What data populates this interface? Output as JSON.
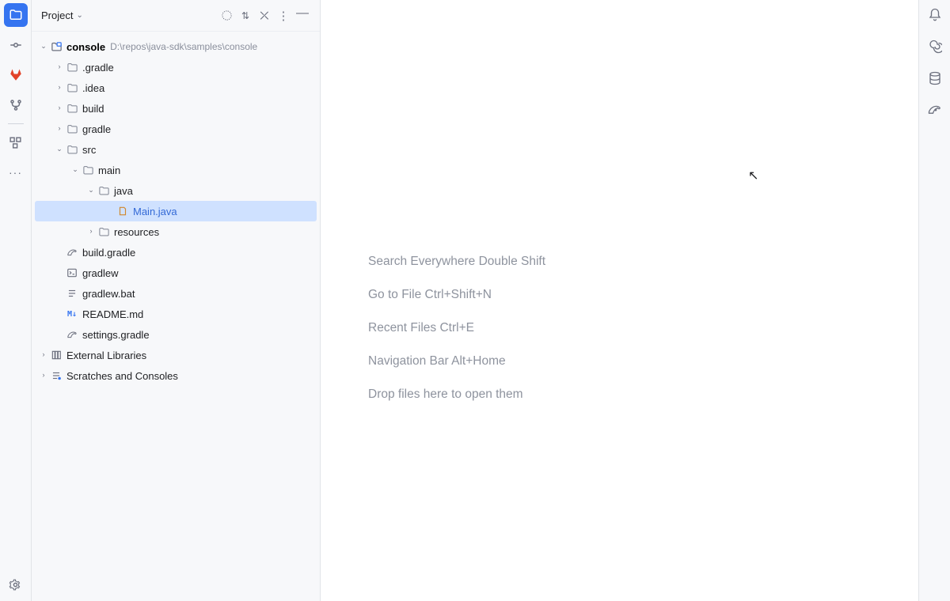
{
  "project_panel": {
    "title": "Project",
    "root": {
      "name": "console",
      "path": "D:\\repos\\java-sdk\\samples\\console"
    },
    "nodes": [
      {
        "depth": 0,
        "arrow": "open",
        "icon": "folder-root",
        "label": "console",
        "hint": "D:\\repos\\java-sdk\\samples\\console",
        "bold": true
      },
      {
        "depth": 1,
        "arrow": "closed",
        "icon": "folder",
        "label": ".gradle"
      },
      {
        "depth": 1,
        "arrow": "closed",
        "icon": "folder",
        "label": ".idea"
      },
      {
        "depth": 1,
        "arrow": "closed",
        "icon": "folder",
        "label": "build"
      },
      {
        "depth": 1,
        "arrow": "closed",
        "icon": "folder",
        "label": "gradle"
      },
      {
        "depth": 1,
        "arrow": "open",
        "icon": "folder",
        "label": "src"
      },
      {
        "depth": 2,
        "arrow": "open",
        "icon": "folder",
        "label": "main"
      },
      {
        "depth": 3,
        "arrow": "open",
        "icon": "folder",
        "label": "java"
      },
      {
        "depth": 4,
        "arrow": "none",
        "icon": "java",
        "label": "Main.java",
        "selected": true
      },
      {
        "depth": 3,
        "arrow": "closed",
        "icon": "folder",
        "label": "resources"
      },
      {
        "depth": 1,
        "arrow": "none",
        "icon": "gradle",
        "label": "build.gradle"
      },
      {
        "depth": 1,
        "arrow": "none",
        "icon": "term",
        "label": "gradlew"
      },
      {
        "depth": 1,
        "arrow": "none",
        "icon": "text",
        "label": "gradlew.bat"
      },
      {
        "depth": 1,
        "arrow": "none",
        "icon": "md",
        "label": "README.md"
      },
      {
        "depth": 1,
        "arrow": "none",
        "icon": "gradle",
        "label": "settings.gradle"
      },
      {
        "depth": 0,
        "arrow": "closed",
        "icon": "lib",
        "label": "External Libraries"
      },
      {
        "depth": 0,
        "arrow": "closed",
        "icon": "scratch",
        "label": "Scratches and Consoles"
      }
    ]
  },
  "editor_tips": [
    {
      "label": "Search Everywhere",
      "shortcut": "Double Shift"
    },
    {
      "label": "Go to File",
      "shortcut": "Ctrl+Shift+N"
    },
    {
      "label": "Recent Files",
      "shortcut": "Ctrl+E"
    },
    {
      "label": "Navigation Bar",
      "shortcut": "Alt+Home"
    },
    {
      "label": "Drop files here to open them",
      "shortcut": ""
    }
  ],
  "left_toolbar": {
    "project": "Project",
    "commit": "Commit",
    "gitlab": "GitLab",
    "structure": "Structure",
    "services": "Services",
    "more": "More"
  },
  "right_toolbar": {
    "notifications": "Notifications",
    "ai": "AI Assistant",
    "database": "Database",
    "gradle": "Gradle"
  }
}
